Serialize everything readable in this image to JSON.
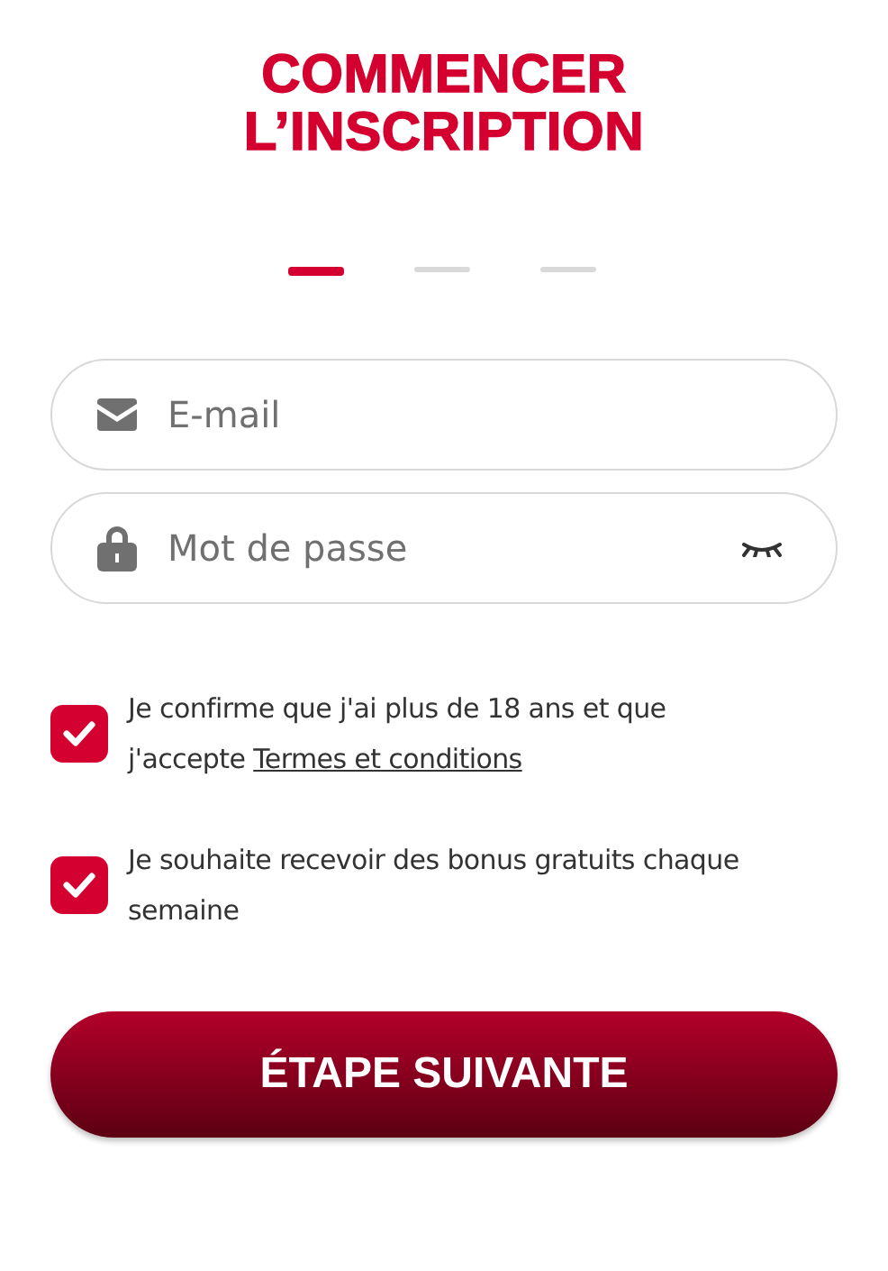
{
  "title_lines": [
    "COMMENCER",
    "L’INSCRIPTION"
  ],
  "steps": [
    {
      "selected": true
    },
    {
      "selected": false
    },
    {
      "selected": false
    }
  ],
  "fields": [
    {
      "kind": "email",
      "placeholder": "E-mail"
    },
    {
      "kind": "password",
      "placeholder": "Mot de passe"
    }
  ],
  "consents": [
    {
      "checked": true,
      "text": "Je confirme que j'ai plus de 18 ans et que j'accepte",
      "link": "Termes et conditions"
    },
    {
      "checked": true,
      "text": "Je souhaite recevoir des bonus gratuits chaque semaine"
    }
  ],
  "button": "ÉTAPE SUIVANTE"
}
